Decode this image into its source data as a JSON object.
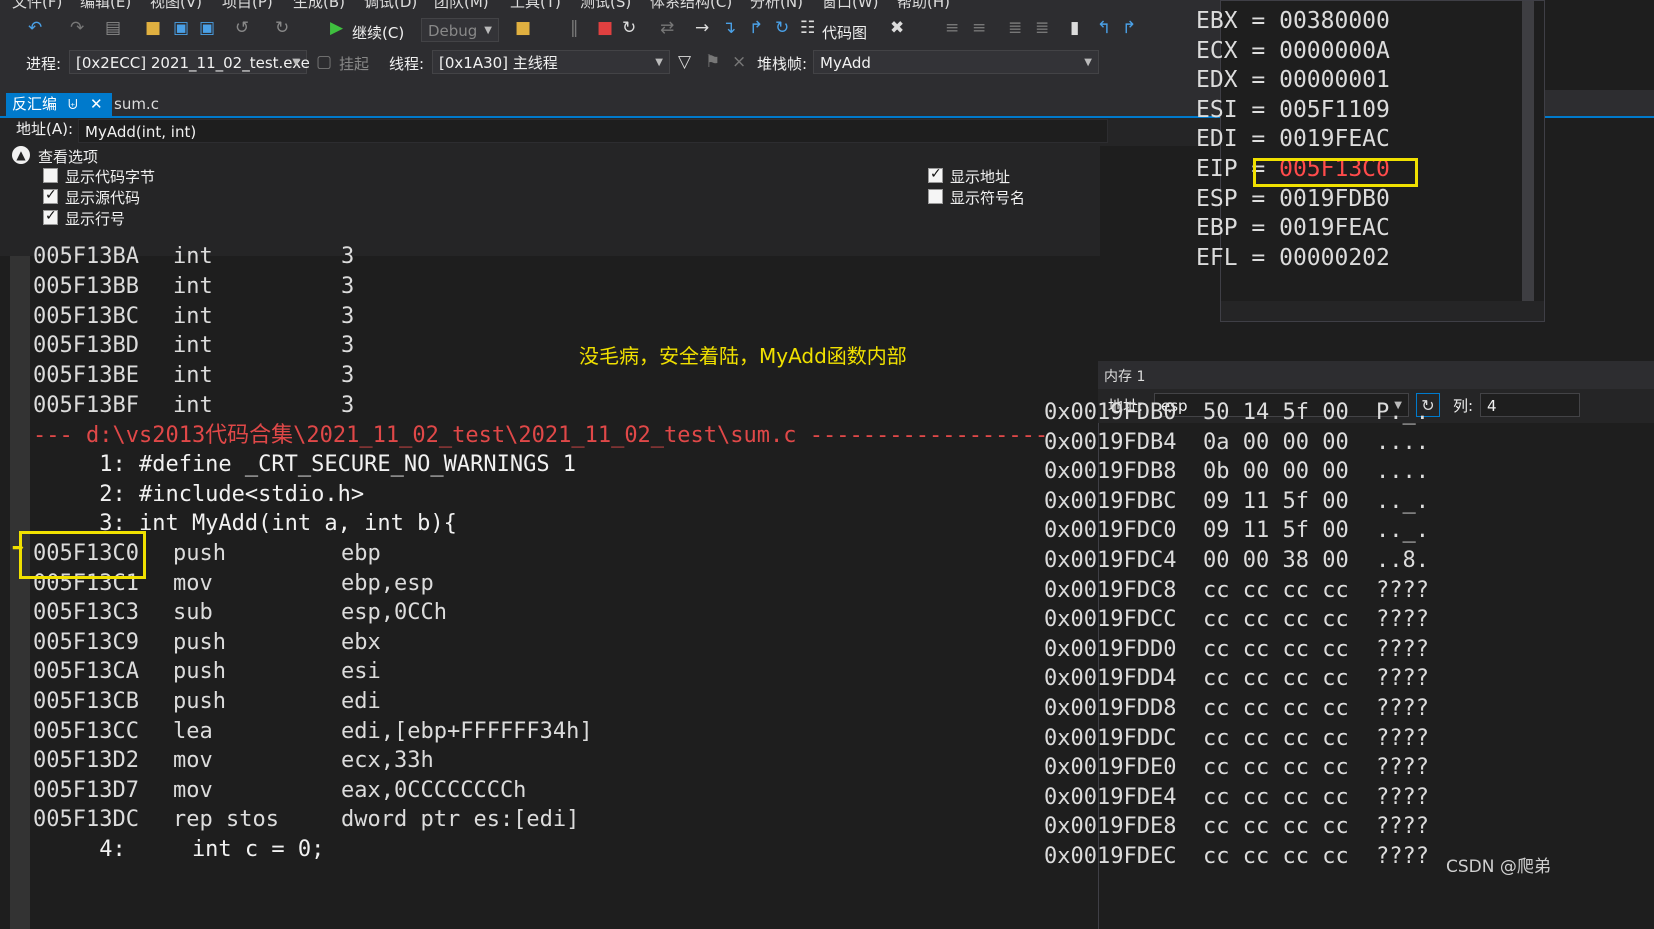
{
  "menu": [
    "文件(F)",
    "编辑(E)",
    "视图(V)",
    "项目(P)",
    "生成(B)",
    "调试(D)",
    "团队(M)",
    "工具(T)",
    "测试(S)",
    "体系结构(C)",
    "分析(N)",
    "窗口(W)",
    "帮助(H)"
  ],
  "toolbar": {
    "continue": "继续(C)",
    "config": "Debug",
    "codemap": "代码图"
  },
  "process_bar": {
    "process_label": "进程:",
    "process_value": "[0x2ECC] 2021_11_02_test.exe",
    "suspend": "挂起",
    "thread_label": "线程:",
    "thread_value": "[0x1A30] 主线程",
    "stack_label": "堆栈帧:",
    "stack_value": "MyAdd"
  },
  "tabs": {
    "disasm": "反汇编",
    "file": "sum.c"
  },
  "address": {
    "label": "地址(A):",
    "value": "MyAdd(int, int)"
  },
  "view_options": {
    "title": "查看选项",
    "code_bytes": "显示代码字节",
    "source": "显示源代码",
    "line_numbers": "显示行号",
    "show_address": "显示地址",
    "symbol_names": "显示符号名"
  },
  "code_lines": [
    {
      "addr": "005F13BA",
      "m": "int",
      "op": "3"
    },
    {
      "addr": "005F13BB",
      "m": "int",
      "op": "3"
    },
    {
      "addr": "005F13BC",
      "m": "int",
      "op": "3"
    },
    {
      "addr": "005F13BD",
      "m": "int",
      "op": "3"
    },
    {
      "addr": "005F13BE",
      "m": "int",
      "op": "3"
    },
    {
      "addr": "005F13BF",
      "m": "int",
      "op": "3"
    }
  ],
  "file_line": "--- d:\\vs2013代码合集\\2021_11_02_test\\2021_11_02_test\\sum.c ------------------",
  "src1": "     1: #define _CRT_SECURE_NO_WARNINGS 1",
  "src2": "     2: #include<stdio.h>",
  "src3": "     3: int MyAdd(int a, int b){",
  "code_lines2": [
    {
      "addr": "005F13C0",
      "m": "push",
      "op": "ebp"
    },
    {
      "addr": "005F13C1",
      "m": "mov",
      "op": "ebp,esp"
    },
    {
      "addr": "005F13C3",
      "m": "sub",
      "op": "esp,0CCh"
    },
    {
      "addr": "005F13C9",
      "m": "push",
      "op": "ebx"
    },
    {
      "addr": "005F13CA",
      "m": "push",
      "op": "esi"
    },
    {
      "addr": "005F13CB",
      "m": "push",
      "op": "edi"
    },
    {
      "addr": "005F13CC",
      "m": "lea",
      "op": "edi,[ebp+FFFFFF34h]"
    },
    {
      "addr": "005F13D2",
      "m": "mov",
      "op": "ecx,33h"
    },
    {
      "addr": "005F13D7",
      "m": "mov",
      "op": "eax,0CCCCCCCCh"
    },
    {
      "addr": "005F13DC",
      "m": "rep stos",
      "op": "dword ptr es:[edi]"
    }
  ],
  "src4": "     4:     int c = 0;",
  "annotation": "没毛病，安全着陆，MyAdd函数内部",
  "registers": [
    {
      "n": "EBX",
      "v": "00380000"
    },
    {
      "n": "ECX",
      "v": "0000000A"
    },
    {
      "n": "EDX",
      "v": "00000001"
    },
    {
      "n": "ESI",
      "v": "005F1109"
    },
    {
      "n": "EDI",
      "v": "0019FEAC"
    },
    {
      "n": "EIP",
      "v": "005F13C0"
    },
    {
      "n": "ESP",
      "v": "0019FDB0"
    },
    {
      "n": "EBP",
      "v": "0019FEAC"
    },
    {
      "n": "EFL",
      "v": "00000202"
    }
  ],
  "memory": {
    "title": "内存 1",
    "addr_label": "地址:",
    "addr_value": "esp",
    "col_label": "列:",
    "col_value": "4",
    "rows": [
      {
        "a": "0x0019FDB0",
        "b": "50 14 5f 00",
        "t": "P._."
      },
      {
        "a": "0x0019FDB4",
        "b": "0a 00 00 00",
        "t": "...."
      },
      {
        "a": "0x0019FDB8",
        "b": "0b 00 00 00",
        "t": "...."
      },
      {
        "a": "0x0019FDBC",
        "b": "09 11 5f 00",
        "t": ".._."
      },
      {
        "a": "0x0019FDC0",
        "b": "09 11 5f 00",
        "t": ".._."
      },
      {
        "a": "0x0019FDC4",
        "b": "00 00 38 00",
        "t": "..8."
      },
      {
        "a": "0x0019FDC8",
        "b": "cc cc cc cc",
        "t": "????"
      },
      {
        "a": "0x0019FDCC",
        "b": "cc cc cc cc",
        "t": "????"
      },
      {
        "a": "0x0019FDD0",
        "b": "cc cc cc cc",
        "t": "????"
      },
      {
        "a": "0x0019FDD4",
        "b": "cc cc cc cc",
        "t": "????"
      },
      {
        "a": "0x0019FDD8",
        "b": "cc cc cc cc",
        "t": "????"
      },
      {
        "a": "0x0019FDDC",
        "b": "cc cc cc cc",
        "t": "????"
      },
      {
        "a": "0x0019FDE0",
        "b": "cc cc cc cc",
        "t": "????"
      },
      {
        "a": "0x0019FDE4",
        "b": "cc cc cc cc",
        "t": "????"
      },
      {
        "a": "0x0019FDE8",
        "b": "cc cc cc cc",
        "t": "????"
      },
      {
        "a": "0x0019FDEC",
        "b": "cc cc cc cc",
        "t": "????"
      }
    ]
  },
  "watermark": "CSDN @爬弟",
  "colors": {
    "accent": "#007acc",
    "highlight_box": "#f0e000",
    "source_path": "#e04848",
    "annotation": "#f0e000"
  }
}
